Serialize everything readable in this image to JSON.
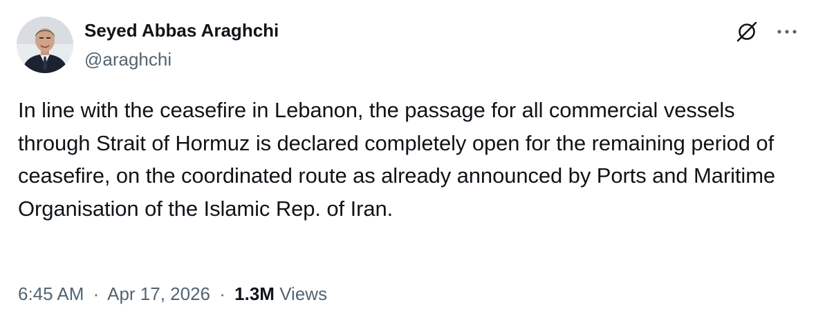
{
  "author": {
    "display_name": "Seyed Abbas Araghchi",
    "handle": "@araghchi",
    "avatar_icon": "profile-photo"
  },
  "header_actions": {
    "grok_icon": "grok-icon",
    "more_icon": "more-horizontal-icon"
  },
  "tweet": {
    "text": "In line with the ceasefire in Lebanon, the passage for all commercial vessels through Strait of Hormuz is declared completely open for the remaining period of ceasefire, on the coordinated route as already announced by Ports and Maritime Organisation of the Islamic Rep. of Iran."
  },
  "meta": {
    "time": "6:45 AM",
    "separator": "·",
    "date": "Apr 17, 2026",
    "views_count": "1.3M",
    "views_label": "Views"
  },
  "colors": {
    "text_primary": "#0f1419",
    "text_secondary": "#536471",
    "background": "#ffffff"
  }
}
